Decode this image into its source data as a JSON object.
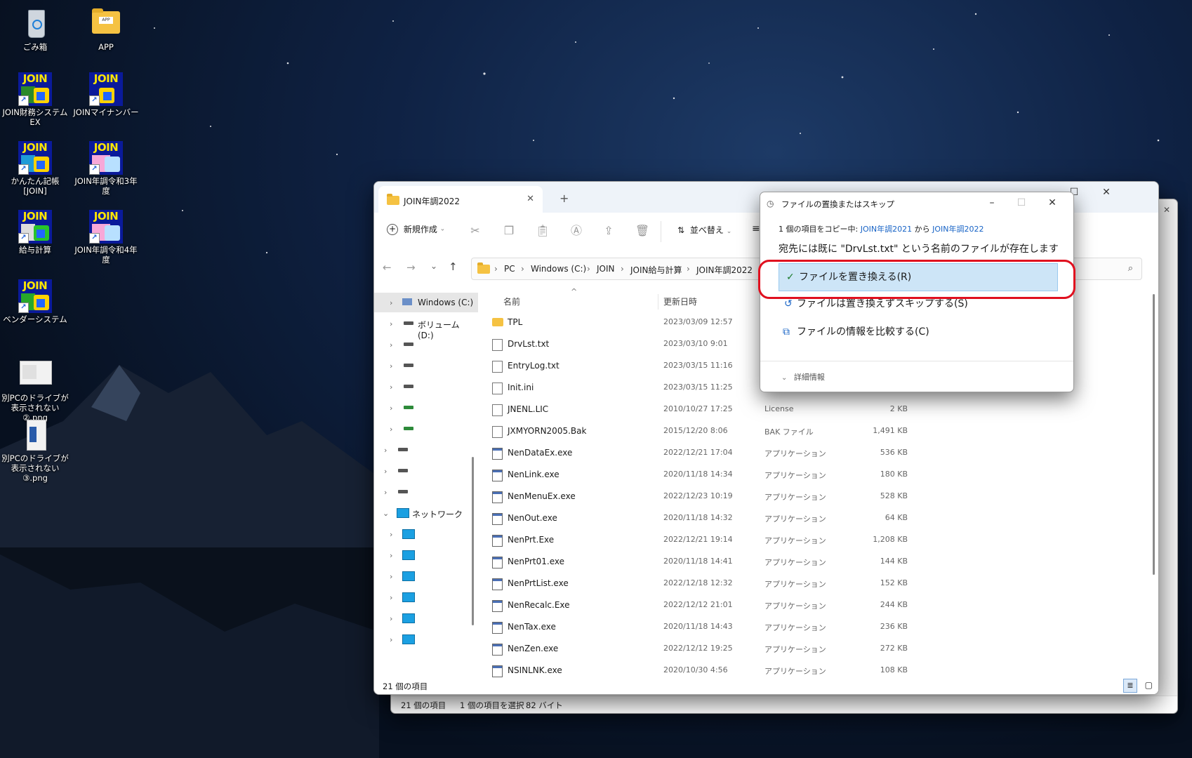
{
  "desktop": {
    "icons": [
      {
        "label": "ごみ箱",
        "icon": "recycle-bin-icon"
      },
      {
        "label": "APP",
        "icon": "folder-icon"
      },
      {
        "label": "JOIN財務システム EX",
        "icon": "join-app-icon"
      },
      {
        "label": "JOINマイナンバー",
        "icon": "join-app-icon"
      },
      {
        "label": "かんたん記帳[JOIN]",
        "icon": "join-app-icon"
      },
      {
        "label": "JOIN年調令和3年度",
        "icon": "join-app-icon"
      },
      {
        "label": "給与計算",
        "icon": "join-app-icon"
      },
      {
        "label": "JOIN年調令和4年度",
        "icon": "join-app-icon"
      },
      {
        "label": "ベンダーシステム",
        "icon": "join-app-icon"
      },
      {
        "label": "別PCのドライブが表示されない②.png",
        "icon": "image-file-icon"
      },
      {
        "label": "別PCのドライブが表示されない③.png",
        "icon": "image-file-icon"
      }
    ],
    "join_logo": "JOIN",
    "app_folder_tag": "APP"
  },
  "back_window": {
    "status": {
      "count": "21 個の項目",
      "selected": "1 個の項目を選択",
      "size": "82 バイト"
    }
  },
  "explorer": {
    "tab_title": "JOIN年調2022",
    "new_tab": "+",
    "toolbar": {
      "new_label": "新規作成",
      "sort_label": "並べ替え"
    },
    "breadcrumb": [
      "PC",
      "Windows (C:)",
      "JOIN",
      "JOIN給与計算",
      "JOIN年調2022"
    ],
    "nav": {
      "windows_c": "Windows (C:)",
      "volume_d": "ボリューム (D:)",
      "network": "ネットワーク"
    },
    "columns": {
      "name": "名前",
      "modified": "更新日時"
    },
    "files": [
      {
        "name": "TPL",
        "date": "2023/03/09 12:57",
        "type": "",
        "size": "",
        "kind": "folder"
      },
      {
        "name": "DrvLst.txt",
        "date": "2023/03/10 9:01",
        "type": "",
        "size": "",
        "kind": "txt"
      },
      {
        "name": "EntryLog.txt",
        "date": "2023/03/15 11:16",
        "type": "",
        "size": "",
        "kind": "txt"
      },
      {
        "name": "Init.ini",
        "date": "2023/03/15 11:25",
        "type": "",
        "size": "",
        "kind": "txt"
      },
      {
        "name": "JNENL.LIC",
        "date": "2010/10/27 17:25",
        "type": "License",
        "size": "2 KB",
        "kind": "txt"
      },
      {
        "name": "JXMYORN2005.Bak",
        "date": "2015/12/20 8:06",
        "type": "BAK ファイル",
        "size": "1,491 KB",
        "kind": "txt"
      },
      {
        "name": "NenDataEx.exe",
        "date": "2022/12/21 17:04",
        "type": "アプリケーション",
        "size": "536 KB",
        "kind": "exe"
      },
      {
        "name": "NenLink.exe",
        "date": "2020/11/18 14:34",
        "type": "アプリケーション",
        "size": "180 KB",
        "kind": "exe"
      },
      {
        "name": "NenMenuEx.exe",
        "date": "2022/12/23 10:19",
        "type": "アプリケーション",
        "size": "528 KB",
        "kind": "exe"
      },
      {
        "name": "NenOut.exe",
        "date": "2020/11/18 14:32",
        "type": "アプリケーション",
        "size": "64 KB",
        "kind": "exe"
      },
      {
        "name": "NenPrt.Exe",
        "date": "2022/12/21 19:14",
        "type": "アプリケーション",
        "size": "1,208 KB",
        "kind": "exe"
      },
      {
        "name": "NenPrt01.exe",
        "date": "2020/11/18 14:41",
        "type": "アプリケーション",
        "size": "144 KB",
        "kind": "exe"
      },
      {
        "name": "NenPrtList.exe",
        "date": "2022/12/18 12:32",
        "type": "アプリケーション",
        "size": "152 KB",
        "kind": "exe"
      },
      {
        "name": "NenRecalc.Exe",
        "date": "2022/12/12 21:01",
        "type": "アプリケーション",
        "size": "244 KB",
        "kind": "exe"
      },
      {
        "name": "NenTax.exe",
        "date": "2020/11/18 14:43",
        "type": "アプリケーション",
        "size": "236 KB",
        "kind": "exe"
      },
      {
        "name": "NenZen.exe",
        "date": "2022/12/12 19:25",
        "type": "アプリケーション",
        "size": "272 KB",
        "kind": "exe"
      },
      {
        "name": "NSINLNK.exe",
        "date": "2020/10/30 4:56",
        "type": "アプリケーション",
        "size": "108 KB",
        "kind": "exe"
      }
    ],
    "status": "21 個の項目"
  },
  "dialog": {
    "title": "ファイルの置換またはスキップ",
    "progress_prefix": "1 個の項目をコピー中:",
    "source": "JOIN年調2021",
    "from_word": "から",
    "dest": "JOIN年調2022",
    "message": "宛先には既に \"DrvLst.txt\" という名前のファイルが存在します",
    "options": {
      "replace": "ファイルを置き換える(R)",
      "skip": "ファイルは置き換えずスキップする(S)",
      "compare": "ファイルの情報を比較する(C)"
    },
    "details": "詳細情報"
  },
  "colors": {
    "link": "#1763c6",
    "highlight": "#cde5f7",
    "annotation": "#e0101f"
  }
}
